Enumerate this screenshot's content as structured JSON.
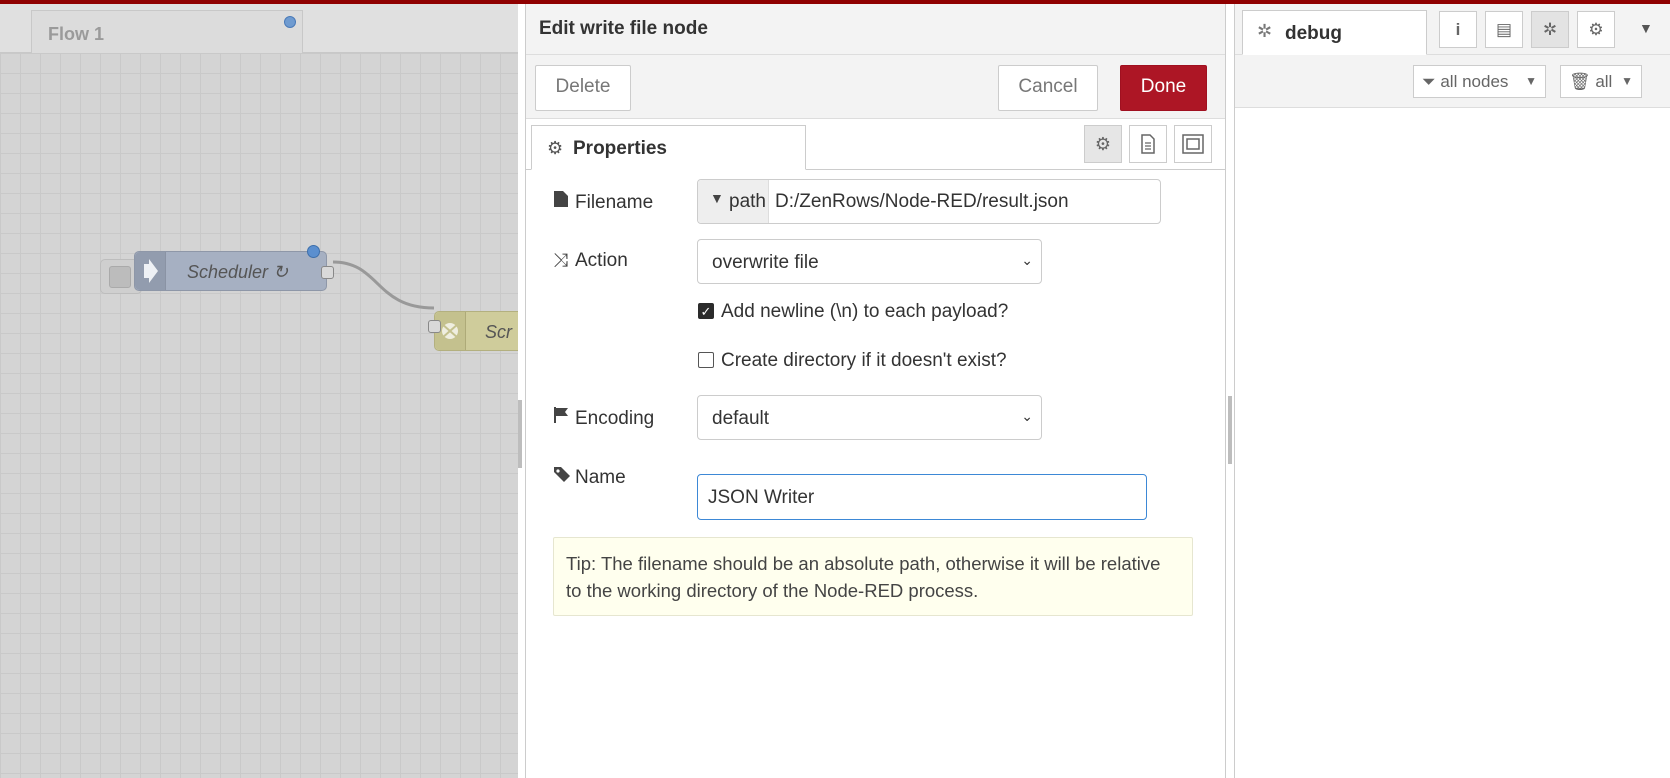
{
  "workspace": {
    "flow_tab_label": "Flow 1",
    "nodes": [
      {
        "label": "Scheduler ↻"
      },
      {
        "label": "Scr"
      }
    ]
  },
  "tray": {
    "title": "Edit write file node",
    "delete_label": "Delete",
    "cancel_label": "Cancel",
    "done_label": "Done",
    "properties_tab": "Properties",
    "filename_label": "Filename",
    "filename_type": "path",
    "filename_value": "D:/ZenRows/Node-RED/result.json",
    "action_label": "Action",
    "action_value": "overwrite file",
    "newline_label": "Add newline (\\n) to each payload?",
    "newline_checked": true,
    "create_dir_label": "Create directory if it doesn't exist?",
    "create_dir_checked": false,
    "encoding_label": "Encoding",
    "encoding_value": "default",
    "name_label": "Name",
    "name_value": "JSON Writer",
    "tip": "Tip: The filename should be an absolute path, otherwise it will be relative to the working directory of the Node-RED process."
  },
  "sidebar": {
    "debug_tab": "debug",
    "filter_nodes": "all nodes",
    "clear_all": "all"
  },
  "colors": {
    "done_button": "#ad1625",
    "header_bar": "#8f0000",
    "scheduler_node": "#a6b0c2",
    "scraper_node": "#cfcc9b"
  }
}
